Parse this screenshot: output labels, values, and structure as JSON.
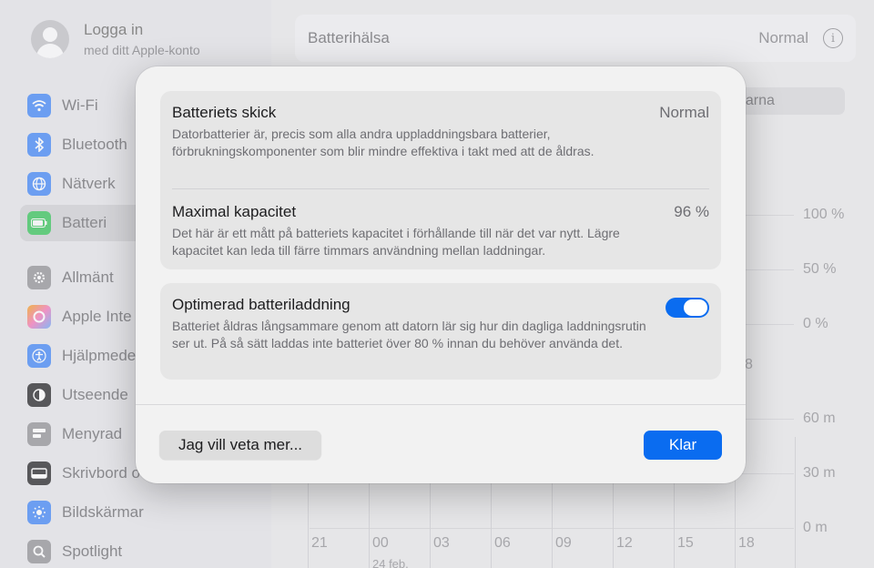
{
  "sidebar": {
    "account": {
      "name": "Logga in",
      "subtitle": "med ditt Apple-konto"
    },
    "items": [
      {
        "label": "Wi-Fi",
        "icon": "wifi-icon",
        "color": "#3b82f6"
      },
      {
        "label": "Bluetooth",
        "icon": "bluetooth-icon",
        "color": "#3b82f6"
      },
      {
        "label": "Nätverk",
        "icon": "globe-icon",
        "color": "#3b82f6"
      },
      {
        "label": "Batteri",
        "icon": "battery-icon",
        "color": "#34c759"
      },
      {
        "label": "Allmänt",
        "icon": "gear-icon",
        "color": "#8e8e93"
      },
      {
        "label": "Apple Inte",
        "icon": "apple-intelligence-icon",
        "color": "#f472b6"
      },
      {
        "label": "Hjälpmede",
        "icon": "accessibility-icon",
        "color": "#3b82f6"
      },
      {
        "label": "Utseende",
        "icon": "appearance-icon",
        "color": "#1d1d1f"
      },
      {
        "label": "Menyrad",
        "icon": "menubar-icon",
        "color": "#8e8e93"
      },
      {
        "label": "Skrivbord o",
        "icon": "desktop-icon",
        "color": "#1d1d1f"
      },
      {
        "label": "Bildskärmar",
        "icon": "display-icon",
        "color": "#3b82f6"
      },
      {
        "label": "Spotlight",
        "icon": "spotlight-icon",
        "color": "#8e8e93"
      }
    ]
  },
  "main": {
    "header_title": "Batterihälsa",
    "header_status": "Normal",
    "segment_label": "garna",
    "chart_ticks_pct": [
      "100 %",
      "50 %",
      "0 %"
    ],
    "chart_ticks_min": [
      "60 m",
      "30 m",
      "0 m"
    ],
    "chart_x": [
      "21",
      "00",
      "03",
      "06",
      "09",
      "12",
      "15",
      "18"
    ],
    "chart_partial": "8",
    "chart_date": "24 feb."
  },
  "dialog": {
    "condition_title": "Batteriets skick",
    "condition_value": "Normal",
    "condition_desc": "Datorbatterier är, precis som alla andra uppladdningsbara batterier, förbrukningskomponenter som blir mindre effektiva i takt med att de åldras.",
    "capacity_title": "Maximal kapacitet",
    "capacity_value": "96 %",
    "capacity_desc": "Det här är ett mått på batteriets kapacitet i förhållande till när det var nytt. Lägre kapacitet kan leda till färre timmars användning mellan laddningar.",
    "optimized_title": "Optimerad batteriladdning",
    "optimized_desc": "Batteriet åldras långsammare genom att datorn lär sig hur din dagliga laddningsrutin ser ut. På så sätt laddas inte batteriet över 80 % innan du behöver använda det.",
    "optimized_enabled": true,
    "learn_more_label": "Jag vill veta mer...",
    "done_label": "Klar"
  },
  "colors": {
    "accent": "#0a6cf0"
  }
}
